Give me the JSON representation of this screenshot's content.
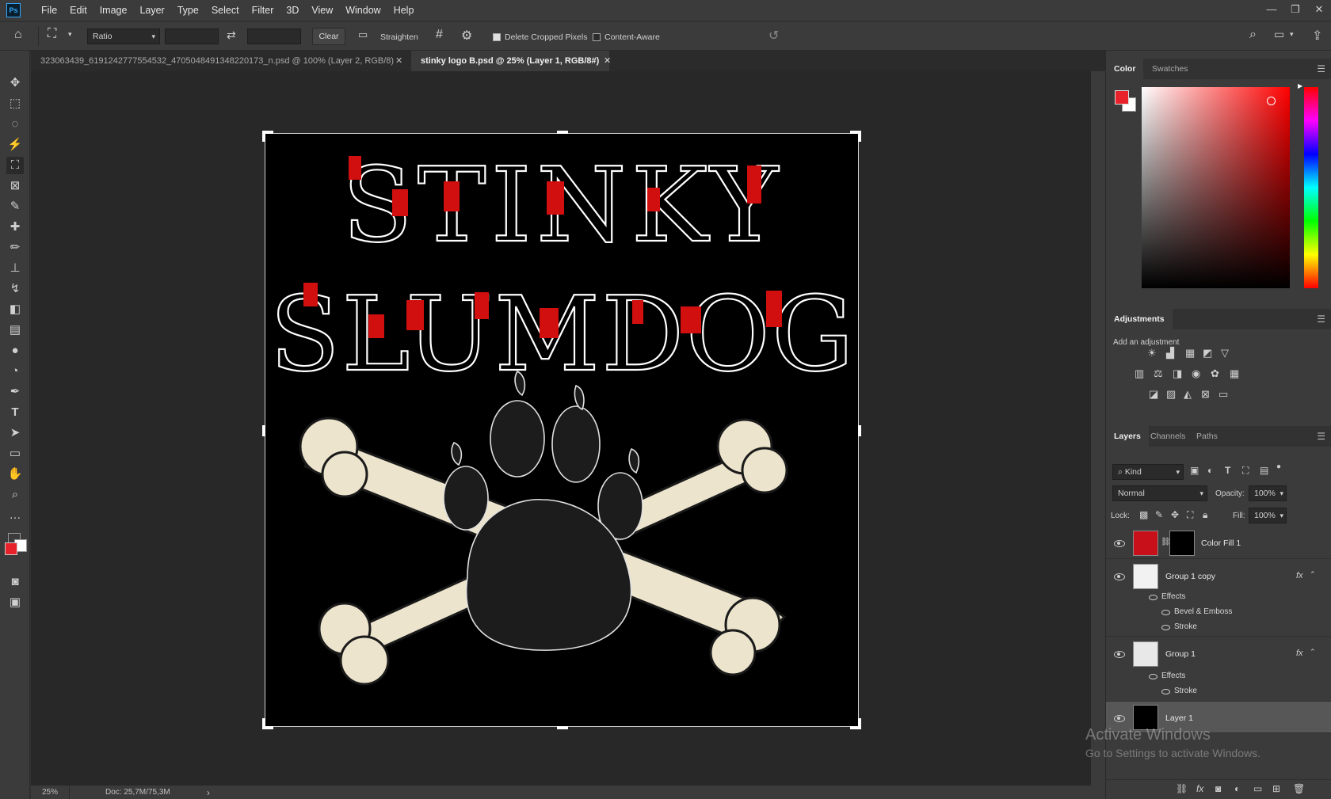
{
  "app": {
    "logo": "Ps"
  },
  "menu": [
    "File",
    "Edit",
    "Image",
    "Layer",
    "Type",
    "Select",
    "Filter",
    "3D",
    "View",
    "Window",
    "Help"
  ],
  "window_controls": {
    "minimize": "—",
    "restore": "❐",
    "close": "✕"
  },
  "options": {
    "ratio_label": "Ratio",
    "width_value": "",
    "height_value": "",
    "clear_label": "Clear",
    "straighten_label": "Straighten",
    "delete_cropped_label": "Delete Cropped Pixels",
    "delete_cropped_checked": true,
    "content_aware_label": "Content-Aware",
    "content_aware_checked": false
  },
  "tabs": [
    {
      "label": "323063439_619124277755453​2_4705048491348220173_n.psd @ 100% (Layer 2, RGB/8)",
      "active": false
    },
    {
      "label": "stinky logo B.psd @ 25% (Layer 1, RGB/8#)",
      "active": true
    }
  ],
  "artwork": {
    "line1": "STINKY",
    "line2": "SLUMDOG",
    "accent_color": "#d10f0f"
  },
  "status": {
    "zoom": "25%",
    "doc": "Doc: 25,7M/75,3M",
    "arrow": "›"
  },
  "color_panel": {
    "tabs": [
      "Color",
      "Swatches"
    ],
    "foreground": "#e8222a",
    "background": "#ffffff"
  },
  "adjustments": {
    "title": "Adjustments",
    "subtitle": "Add an adjustment"
  },
  "layers_panel": {
    "tabs": [
      "Layers",
      "Channels",
      "Paths"
    ],
    "filter_kind": "Kind",
    "blend_mode": "Normal",
    "opacity_label": "Opacity:",
    "opacity_value": "100%",
    "lock_label": "Lock:",
    "fill_label": "Fill:",
    "fill_value": "100%",
    "layers": [
      {
        "name": "Color Fill 1",
        "fx": ""
      },
      {
        "name": "Group 1 copy",
        "fx": "fx",
        "effects_label": "Effects",
        "effects": [
          "Bevel & Emboss",
          "Stroke"
        ]
      },
      {
        "name": "Group 1",
        "fx": "fx",
        "effects_label": "Effects",
        "effects": [
          "Stroke"
        ]
      },
      {
        "name": "Layer 1",
        "fx": ""
      }
    ]
  },
  "watermark": {
    "line1": "Activate Windows",
    "line2": "Go to Settings to activate Windows."
  }
}
